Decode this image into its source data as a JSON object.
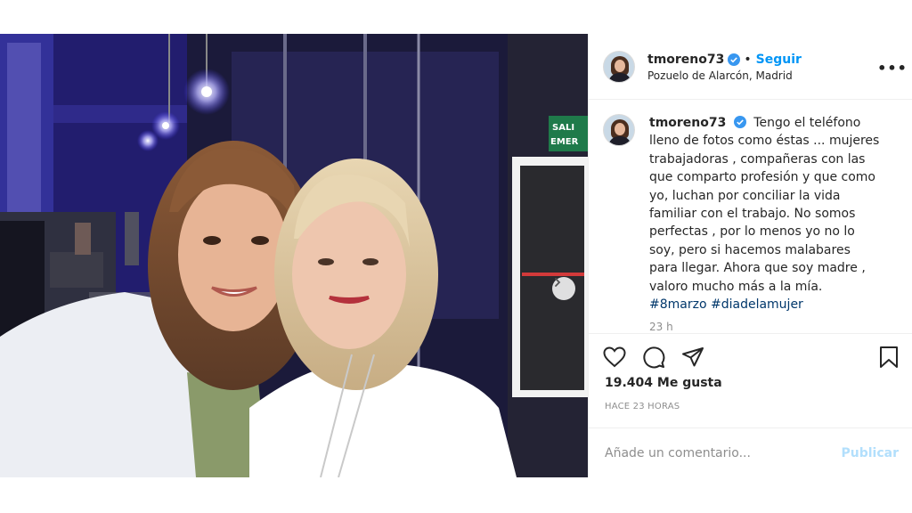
{
  "post": {
    "username": "tmoreno73",
    "follow_label": "Seguir",
    "separator": "•",
    "location": "Pozuelo de Alarcón, Madrid",
    "more_label": "•••",
    "caption": "Tengo el teléfono lleno de fotos como éstas ... mujeres trabajadoras , compañeras con las que comparto profesión y que como yo, luchan por conciliar la vida familiar con el trabajo. No somos perfectas , por lo menos yo no lo soy, pero si hacemos malabares para llegar. Ahora que soy madre , valoro mucho más a la mía.",
    "hashtags": [
      "#8marzo",
      "#diadelamujer"
    ],
    "caption_time": "23 h",
    "likes": "19.404 Me gusta",
    "date": "HACE 23 HORAS",
    "comment_placeholder": "Añade un comentario...",
    "publish_label": "Publicar",
    "photo_sign": "SALIDA EMERG"
  },
  "carousel": {
    "count": 10,
    "active_index": 0
  },
  "colors": {
    "accent": "#0095f6",
    "verified": "#3897f0",
    "publish_disabled": "#b2dffc"
  },
  "icons": [
    "verified-badge-icon",
    "more-options-icon",
    "heart-icon",
    "comment-icon",
    "share-icon",
    "bookmark-icon",
    "chevron-right-icon"
  ]
}
